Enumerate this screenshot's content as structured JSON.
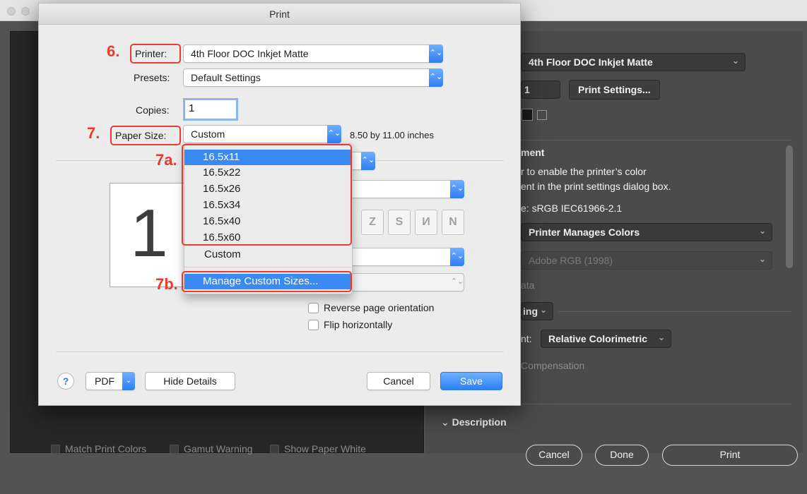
{
  "background": {
    "printer": "4th Floor DOC Inkjet Matte",
    "copies": "1",
    "print_settings_button": "Print Settings...",
    "color_management": {
      "heading_fragment": "ment",
      "notice_line1": "r to enable the printer’s color",
      "notice_line2": "ent in the print settings dialog box.",
      "profile_fragment": "e: sRGB IEC61966-2.1",
      "color_handling": "Printer Manages Colors",
      "printer_profile": "Adobe RGB (1998)",
      "data_fragment": "ata",
      "proof_fragment": "ing",
      "intent_fragment": "nt:",
      "rendering_intent": "Relative Colorimetric",
      "compensation_fragment": "Compensation"
    },
    "description_label": "Description",
    "bottom_checks": [
      "Match Print Colors",
      "Gamut Warning",
      "Show Paper White"
    ],
    "buttons": {
      "cancel": "Cancel",
      "done": "Done",
      "print": "Print"
    }
  },
  "dialog": {
    "title": "Print",
    "printer_label": "Printer:",
    "printer_value": "4th Floor DOC Inkjet Matte",
    "presets_label": "Presets:",
    "presets_value": "Default Settings",
    "copies_label": "Copies:",
    "copies_value": "1",
    "paper_size_label": "Paper Size:",
    "paper_size_value": "Custom",
    "paper_size_dims": "8.50 by 11.00 inches",
    "page_number": "1",
    "reverse_label": "Reverse page orientation",
    "flip_label": "Flip horizontally",
    "buttons": {
      "help": "?",
      "pdf": "PDF",
      "hide_details": "Hide Details",
      "cancel": "Cancel",
      "save": "Save"
    }
  },
  "paper_menu": {
    "items": [
      "16.5x11",
      "16.5x22",
      "16.5x26",
      "16.5x34",
      "16.5x40",
      "16.5x60",
      "Custom"
    ],
    "highlighted_item": "16.5x11",
    "manage": "Manage Custom Sizes..."
  },
  "annotations": {
    "step6": "6.",
    "step7": "7.",
    "step7a": "7a.",
    "step7b": "7b."
  },
  "colors": {
    "annotation": "#ea3b2d",
    "accent": "#3b8af3"
  }
}
